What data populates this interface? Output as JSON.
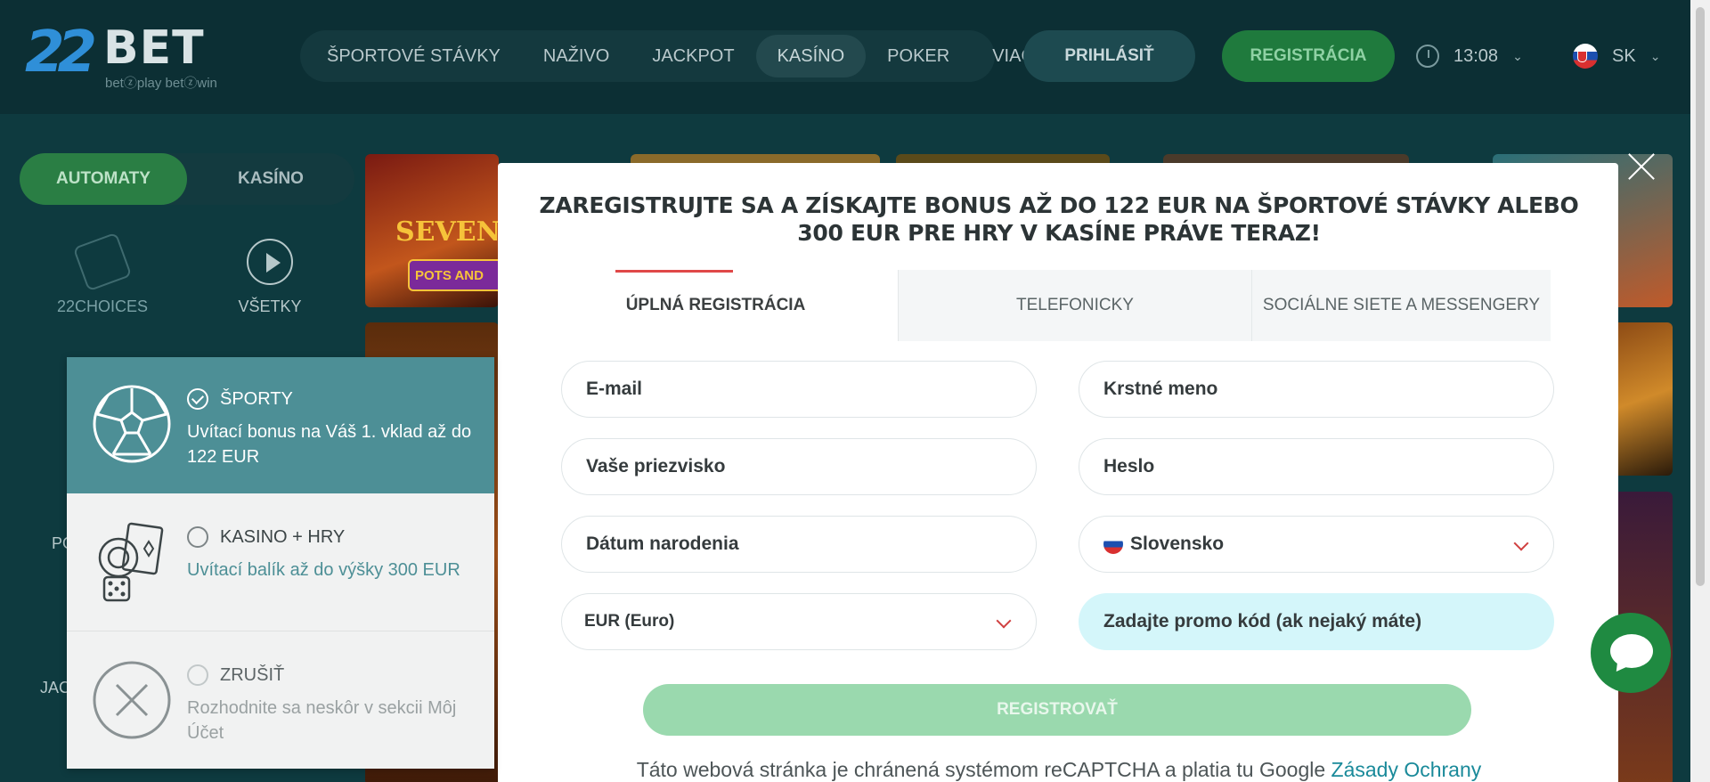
{
  "header": {
    "logo": {
      "num": "22",
      "brand": "BET",
      "tagline": "betⓩplay  betⓩwin"
    },
    "nav": [
      "ŠPORTOVÉ STÁVKY",
      "NAŽIVO",
      "JACKPOT",
      "KASÍNO",
      "POKER",
      "VIAC"
    ],
    "active_nav": "KASÍNO",
    "login_label": "PRIHLÁSIŤ",
    "register_label": "REGISTRÁCIA",
    "time": "13:08",
    "language": "SK"
  },
  "sidebar": {
    "toggle": [
      "AUTOMATY",
      "KASÍNO"
    ],
    "categories": [
      "22CHOICES",
      "VŠETKY"
    ],
    "partial_labels": [
      "PO",
      "JAC"
    ]
  },
  "modal": {
    "title": "ZAREGISTRUJTE SA A ZÍSKAJTE BONUS AŽ DO 122 EUR NA ŠPORTOVÉ STÁVKY ALEBO 300 EUR PRE HRY V KASÍNE PRÁVE TERAZ!",
    "tabs": [
      "ÚPLNÁ REGISTRÁCIA",
      "TELEFONICKY",
      "SOCIÁLNE SIETE A MESSENGERY"
    ],
    "fields": {
      "email": "E-mail",
      "first_name": "Krstné meno",
      "surname": "Vaše priezvisko",
      "password": "Heslo",
      "birthdate": "Dátum narodenia",
      "country": "Slovensko",
      "currency": "EUR (Euro)",
      "promo": "Zadajte promo kód (ak nejaký máte)"
    },
    "submit_label": "REGISTROVAŤ",
    "recaptcha_text": "Táto webová stránka je chránená systémom reCAPTCHA a platia tu Google",
    "recaptcha_link": "Zásady Ochrany"
  },
  "bonus": {
    "options": [
      {
        "title": "ŠPORTY",
        "desc": "Uvítací bonus na Váš 1. vklad až do 122 EUR",
        "selected": true
      },
      {
        "title": "KASINO + HRY",
        "desc": "Uvítací balík až do výšky 300 EUR",
        "selected": false
      },
      {
        "title": "ZRUŠIŤ",
        "desc": "Rozhodnite sa neskôr v sekcii Môj Účet",
        "selected": false
      }
    ]
  },
  "tiles": {
    "t1": "SEVEN",
    "t1b": "POTS AND"
  },
  "colors": {
    "accent_green": "#1f7a3d",
    "teal": "#4d8f96",
    "accent_red": "#e04848"
  }
}
